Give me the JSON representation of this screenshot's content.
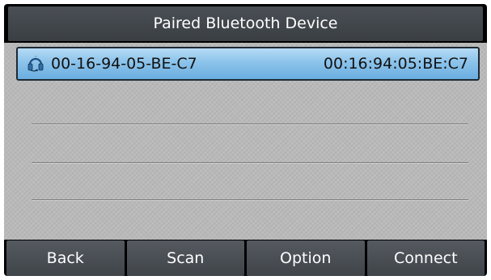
{
  "screen": {
    "title": "Paired Bluetooth Device"
  },
  "devices": [
    {
      "name": "00-16-94-05-BE-C7",
      "mac": "00:16:94:05:BE:C7",
      "icon": "headset-icon",
      "selected": true
    }
  ],
  "softkeys": {
    "back": "Back",
    "scan": "Scan",
    "option": "Option",
    "connect": "Connect"
  },
  "colors": {
    "selection": "#8cc3ea",
    "title_bar": "#42474c",
    "softkey": "#484d52"
  }
}
